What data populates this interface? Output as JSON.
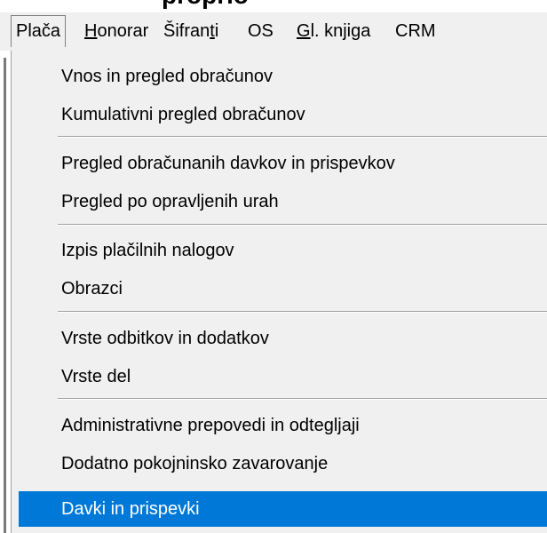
{
  "window": {
    "title": "proprio"
  },
  "menubar": {
    "items": [
      {
        "label": "Plača",
        "active": true
      },
      {
        "label": "Honorar",
        "underline": "H",
        "rest": "onorar"
      },
      {
        "label": "Šifranti",
        "pre": "Šifran",
        "underline": "t",
        "rest": "i"
      },
      {
        "label": "OS"
      },
      {
        "label": "Gl. knjiga",
        "underline": "G",
        "rest": "l. knjiga"
      },
      {
        "label": "CRM"
      }
    ]
  },
  "menu": {
    "items": [
      {
        "label": "Vnos in pregled obračunov"
      },
      {
        "label": "Kumulativni pregled obračunov"
      },
      {
        "label": "Pregled obračunanih davkov in prispevkov"
      },
      {
        "label": "Pregled po opravljenih urah"
      },
      {
        "label": "Izpis plačilnih nalogov"
      },
      {
        "label": "Obrazci"
      },
      {
        "label": "Vrste odbitkov in dodatkov"
      },
      {
        "label": "Vrste del"
      },
      {
        "label": "Administrativne prepovedi in odtegljaji"
      },
      {
        "label": "Dodatno pokojninsko zavarovanje"
      },
      {
        "label": "Davki in prispevki",
        "highlighted": true
      }
    ]
  },
  "colors": {
    "menu_background": "#f0f0f0",
    "highlight": "#0078d7",
    "highlight_text": "#ffffff",
    "separator": "#a0a0a0"
  }
}
